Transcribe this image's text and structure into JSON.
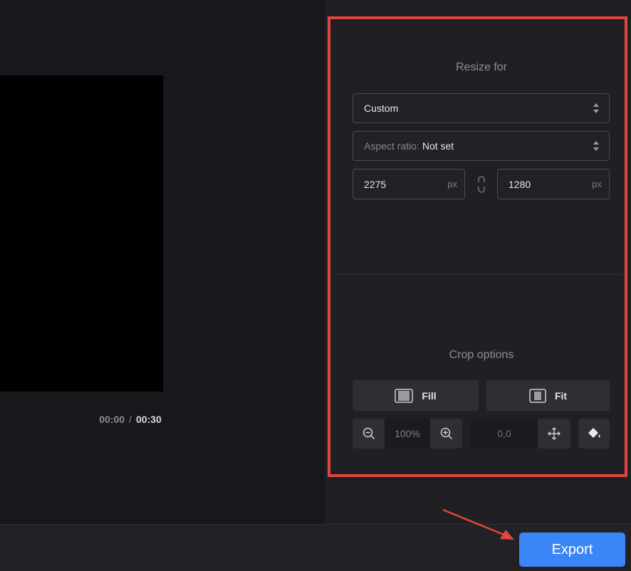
{
  "player": {
    "current_time": "00:00",
    "separator": "/",
    "total_time": "00:30"
  },
  "resize": {
    "title": "Resize for",
    "preset_value": "Custom",
    "aspect_label": "Aspect ratio:",
    "aspect_value": "Not set",
    "width": {
      "value": "2275",
      "unit": "px"
    },
    "height": {
      "value": "1280",
      "unit": "px"
    },
    "link_icon": "link-chain-icon"
  },
  "crop": {
    "title": "Crop options",
    "fill_label": "Fill",
    "fit_label": "Fit",
    "zoom_value": "100%",
    "position_value": "0,0",
    "icons": [
      "zoom-out-icon",
      "zoom-in-icon",
      "move-icon",
      "paint-bucket-icon"
    ]
  },
  "footer": {
    "export_label": "Export"
  },
  "colors": {
    "accent": "#3b86f7",
    "highlight": "#e0463d"
  }
}
